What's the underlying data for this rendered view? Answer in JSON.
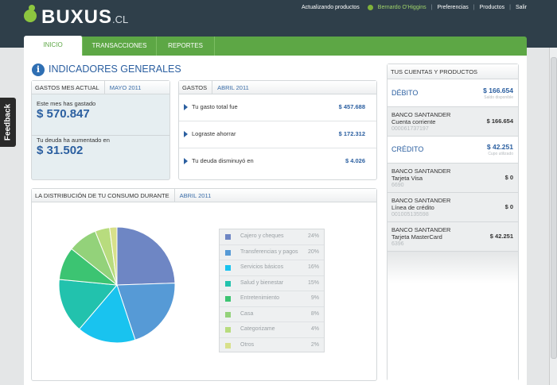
{
  "header": {
    "brand": "BUXUS",
    "tld": ".CL",
    "nav": {
      "updating": "Actualizando productos",
      "user": "Bernardo O'Higgins",
      "preferences": "Preferencias",
      "products": "Productos",
      "logout": "Salir",
      "separator": "|"
    }
  },
  "tabs": [
    "INICIO",
    "TRANSACCIONES",
    "REPORTES"
  ],
  "feedback": "Feedback",
  "page_title": "INDICADORES GENERALES",
  "gastos_mes": {
    "title": "GASTOS MES ACTUAL",
    "period": "MAYO 2011",
    "spent_label": "Este mes has gastado",
    "spent_value": "$ 570.847",
    "debt_label": "Tu deuda ha aumentado en",
    "debt_value": "$ 31.502"
  },
  "gastos": {
    "title": "GASTOS",
    "period": "ABRIL 2011",
    "rows": [
      {
        "label": "Tu gasto total fue",
        "value": "$ 457.688"
      },
      {
        "label": "Lograste ahorrar",
        "value": "$ 172.312"
      },
      {
        "label": "Tu deuda disminuyó en",
        "value": "$ 4.026"
      }
    ]
  },
  "distribucion": {
    "title": "LA DISTRIBUCIÓN DE TU CONSUMO DURANTE",
    "period": "ABRIL 2011"
  },
  "chart_data": {
    "type": "pie",
    "categories": [
      "Cajero y cheques",
      "Transferencias y pagos",
      "Servicios básicos",
      "Salud y bienestar",
      "Entretenimiento",
      "Casa",
      "Categorizame",
      "Otros"
    ],
    "values": [
      24,
      20,
      16,
      15,
      9,
      8,
      4,
      2
    ],
    "labels": [
      "24%",
      "20%",
      "16%",
      "15%",
      "9%",
      "8%",
      "4%",
      "2%"
    ],
    "colors": [
      "#6e86c4",
      "#569ad6",
      "#19c3ef",
      "#22c2ad",
      "#3cc472",
      "#93d27a",
      "#b8dc7e",
      "#d8e08a"
    ],
    "legend": "right"
  },
  "cuentas": {
    "title": "TUS CUENTAS Y PRODUCTOS",
    "debito": {
      "title": "DÉBITO",
      "value": "$ 166.654",
      "sub": "Saldo disponible"
    },
    "debito_rows": [
      {
        "bank": "BANCO SANTANDER",
        "product": "Cuenta corriente",
        "number": "000061737197",
        "amount": "$ 166.654"
      }
    ],
    "credito": {
      "title": "CRÉDITO",
      "value": "$ 42.251",
      "sub": "Cupo utilizado"
    },
    "credito_rows": [
      {
        "bank": "BANCO SANTANDER",
        "product": "Tarjeta Visa",
        "number": "6690",
        "amount": "$ 0"
      },
      {
        "bank": "BANCO SANTANDER",
        "product": "Línea de crédito",
        "number": "001005135598",
        "amount": "$ 0"
      },
      {
        "bank": "BANCO SANTANDER",
        "product": "Tarjeta MasterCard",
        "number": "6396",
        "amount": "$ 42.251"
      }
    ]
  }
}
